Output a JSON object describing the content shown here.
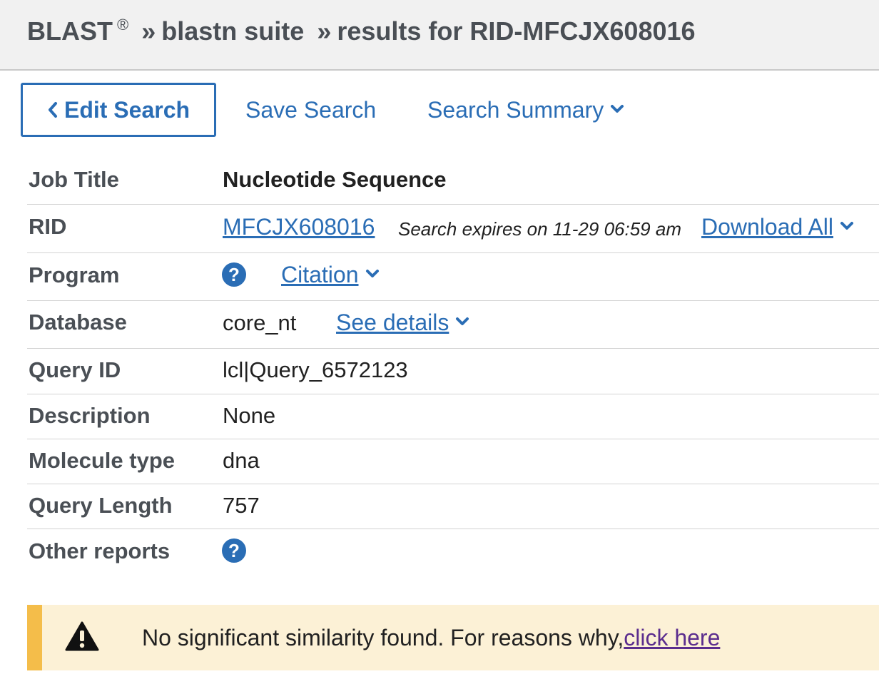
{
  "header": {
    "app": "BLAST",
    "registered_mark": "®",
    "separator": "»",
    "suite": "blastn suite",
    "results": "results for RID-MFCJX608016"
  },
  "toolbar": {
    "edit_search": "Edit Search",
    "save_search": "Save Search",
    "search_summary": "Search Summary"
  },
  "info": {
    "job_title": {
      "label": "Job Title",
      "value": "Nucleotide Sequence"
    },
    "rid": {
      "label": "RID",
      "value": "MFCJX608016",
      "expires": "Search expires on 11-29 06:59 am",
      "download": "Download All"
    },
    "program": {
      "label": "Program",
      "citation": "Citation",
      "help_glyph": "?"
    },
    "database": {
      "label": "Database",
      "value": "core_nt",
      "details": "See details"
    },
    "query_id": {
      "label": "Query ID",
      "value": "lcl|Query_6572123"
    },
    "description": {
      "label": "Description",
      "value": "None"
    },
    "molecule_type": {
      "label": "Molecule type",
      "value": "dna"
    },
    "query_length": {
      "label": "Query Length",
      "value": "757"
    },
    "other_reports": {
      "label": "Other reports",
      "help_glyph": "?"
    }
  },
  "alert": {
    "text": "No significant similarity found. For reasons why,",
    "link": "click here"
  },
  "icons": {
    "help": "help-icon",
    "warning": "warning-icon",
    "chevron_down": "chevron-down-icon",
    "chevron_left": "chevron-left-icon"
  },
  "colors": {
    "link": "#2a6db5",
    "header_bg": "#f1f1f1",
    "alert_bg": "#fcf1d6",
    "alert_accent": "#f4bd4a",
    "visited_link": "#5b2d8e"
  }
}
